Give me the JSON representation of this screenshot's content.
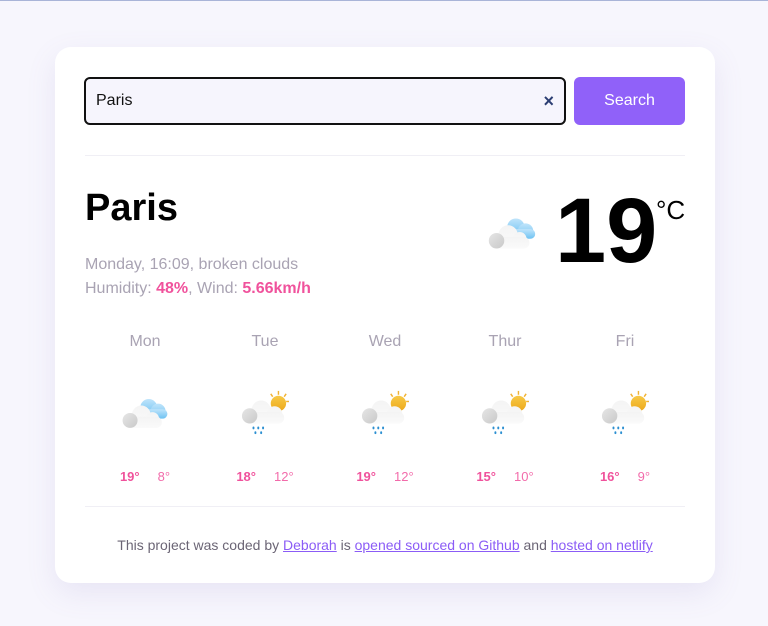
{
  "search": {
    "value": "Paris",
    "clear_icon": "×",
    "button_label": "Search"
  },
  "current": {
    "city": "Paris",
    "description": "Monday, 16:09, broken clouds",
    "humidity_label": "Humidity: ",
    "humidity": "48%",
    "wind_label": ", Wind: ",
    "wind": "5.66km/h",
    "temperature": "19",
    "unit": "°C",
    "icon": "broken-clouds-icon"
  },
  "forecast": [
    {
      "day": "Mon",
      "max": "19°",
      "min": "8°",
      "icon": "broken-clouds-icon"
    },
    {
      "day": "Tue",
      "max": "18°",
      "min": "12°",
      "icon": "sun-rain-icon"
    },
    {
      "day": "Wed",
      "max": "19°",
      "min": "12°",
      "icon": "sun-rain-icon"
    },
    {
      "day": "Thur",
      "max": "15°",
      "min": "10°",
      "icon": "sun-rain-icon"
    },
    {
      "day": "Fri",
      "max": "16°",
      "min": "9°",
      "icon": "sun-rain-icon"
    }
  ],
  "footer": {
    "text1": "This project was coded by ",
    "author": "Deborah",
    "text2": " is ",
    "link1": "opened sourced on Github",
    "text3": " and ",
    "link2": "hosted on netlify"
  },
  "colors": {
    "accent": "#9061f9",
    "highlight": "#f0529c",
    "muted": "#a9a3b3"
  }
}
